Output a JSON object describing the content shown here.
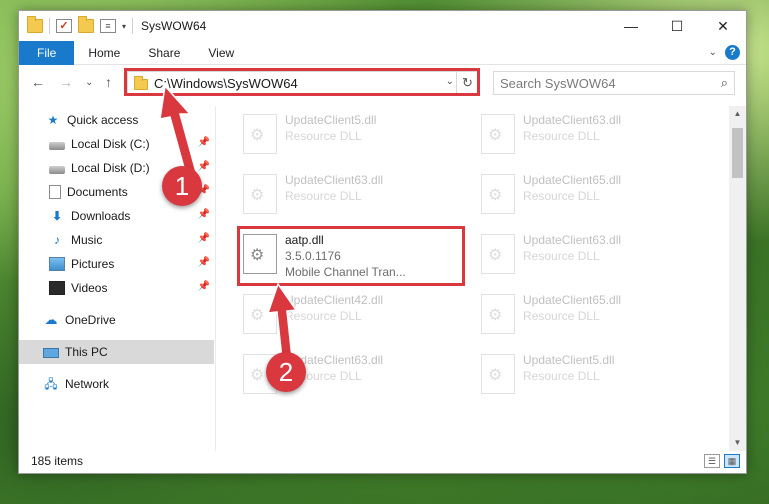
{
  "window": {
    "title": "SysWOW64",
    "caption": {
      "minimize": "—",
      "maximize": "☐",
      "close": "✕"
    }
  },
  "qat": {
    "dropdown": "▾"
  },
  "ribbon": {
    "tabs": [
      "File",
      "Home",
      "Share",
      "View"
    ],
    "collapse": "⌄",
    "help": "?"
  },
  "nav": {
    "back": "←",
    "forward": "→",
    "recent": "⌄",
    "up": "↑",
    "address": "C:\\Windows\\SysWOW64",
    "address_drop": "⌄",
    "refresh": "↻",
    "search_placeholder": "Search SysWOW64",
    "search_glyph": "⌕"
  },
  "sidebar": {
    "items": [
      {
        "label": "Quick access",
        "icon": "star-icon",
        "pinned": false
      },
      {
        "label": "Local Disk (C:)",
        "icon": "drive-icon",
        "pinned": true
      },
      {
        "label": "Local Disk (D:)",
        "icon": "drive-icon",
        "pinned": true
      },
      {
        "label": "Documents",
        "icon": "documents-icon",
        "pinned": true
      },
      {
        "label": "Downloads",
        "icon": "downloads-icon",
        "pinned": true
      },
      {
        "label": "Music",
        "icon": "music-icon",
        "pinned": true
      },
      {
        "label": "Pictures",
        "icon": "pictures-icon",
        "pinned": true
      },
      {
        "label": "Videos",
        "icon": "videos-icon",
        "pinned": true
      },
      {
        "label": "OneDrive",
        "icon": "onedrive-icon",
        "pinned": false
      },
      {
        "label": "This PC",
        "icon": "this-pc-icon",
        "pinned": false,
        "selected": true
      },
      {
        "label": "Network",
        "icon": "network-icon",
        "pinned": false
      }
    ]
  },
  "files": {
    "left": [
      {
        "name": "UpdateClient5.dll",
        "sub": "Resource DLL"
      },
      {
        "name": "UpdateClient63.dll",
        "sub": "Resource DLL"
      },
      {
        "name": "aatp.dll",
        "version": "3.5.0.1176",
        "sub": "Mobile Channel Tran...",
        "highlighted": true
      },
      {
        "name": "UpdateClient42.dll",
        "sub": "Resource DLL"
      },
      {
        "name": "UpdateClient63.dll",
        "sub": "Resource DLL"
      }
    ],
    "right": [
      {
        "name": "UpdateClient63.dll",
        "sub": "Resource DLL"
      },
      {
        "name": "UpdateClient65.dll",
        "sub": "Resource DLL"
      },
      {
        "name": "UpdateClient63.dll",
        "sub": "Resource DLL"
      },
      {
        "name": "UpdateClient65.dll",
        "sub": "Resource DLL"
      },
      {
        "name": "UpdateClient5.dll",
        "sub": "Resource DLL"
      }
    ]
  },
  "scrollbar": {
    "up": "▲",
    "down": "▼"
  },
  "status": {
    "count": "185 items"
  },
  "annotations": {
    "step1": "1",
    "step2": "2",
    "color": "#d9383f"
  },
  "colors": {
    "accent": "#1979ca",
    "highlight": "#d9383f"
  }
}
